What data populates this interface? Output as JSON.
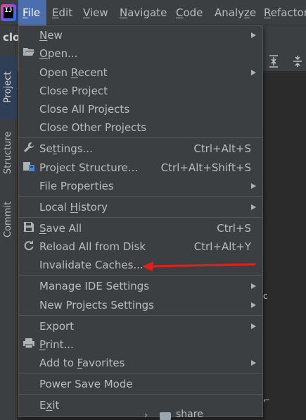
{
  "menubar": {
    "items": [
      {
        "label": "File",
        "mnemonic": "F"
      },
      {
        "label": "Edit",
        "mnemonic": "E"
      },
      {
        "label": "View",
        "mnemonic": "V"
      },
      {
        "label": "Navigate",
        "mnemonic": "N"
      },
      {
        "label": "Code",
        "mnemonic": "C"
      },
      {
        "label": "Analyze",
        "mnemonic": "z"
      },
      {
        "label": "Refactor",
        "mnemonic": "R"
      }
    ],
    "active": "File"
  },
  "left_strip": {
    "tabs": [
      {
        "label": "Project",
        "selected": true
      },
      {
        "label": "Structure",
        "selected": false
      },
      {
        "label": "Commit",
        "selected": false
      }
    ]
  },
  "panel": {
    "title_fragment": "clo"
  },
  "file_menu": {
    "items": [
      {
        "label": "New",
        "shortcut": "",
        "submenu": true,
        "icon": ""
      },
      {
        "label": "Open...",
        "shortcut": "",
        "submenu": false,
        "icon": "folder-open-icon"
      },
      {
        "label": "Open Recent",
        "shortcut": "",
        "submenu": true,
        "icon": ""
      },
      {
        "label": "Close Project",
        "shortcut": "",
        "submenu": false,
        "icon": ""
      },
      {
        "label": "Close All Projects",
        "shortcut": "",
        "submenu": false,
        "icon": ""
      },
      {
        "label": "Close Other Projects",
        "shortcut": "",
        "submenu": false,
        "icon": ""
      },
      {
        "label": "Settings...",
        "shortcut": "Ctrl+Alt+S",
        "submenu": false,
        "icon": "wrench-icon"
      },
      {
        "label": "Project Structure...",
        "shortcut": "Ctrl+Alt+Shift+S",
        "submenu": false,
        "icon": "project-structure-icon"
      },
      {
        "label": "File Properties",
        "shortcut": "",
        "submenu": true,
        "icon": ""
      },
      {
        "label": "Local History",
        "shortcut": "",
        "submenu": true,
        "icon": ""
      },
      {
        "label": "Save All",
        "shortcut": "Ctrl+S",
        "submenu": false,
        "icon": "save-icon"
      },
      {
        "label": "Reload All from Disk",
        "shortcut": "Ctrl+Alt+Y",
        "submenu": false,
        "icon": "reload-icon"
      },
      {
        "label": "Invalidate Caches...",
        "shortcut": "",
        "submenu": false,
        "icon": ""
      },
      {
        "label": "Manage IDE Settings",
        "shortcut": "",
        "submenu": true,
        "icon": ""
      },
      {
        "label": "New Projects Settings",
        "shortcut": "",
        "submenu": true,
        "icon": ""
      },
      {
        "label": "Export",
        "shortcut": "",
        "submenu": true,
        "icon": ""
      },
      {
        "label": "Print...",
        "shortcut": "",
        "submenu": false,
        "icon": "print-icon"
      },
      {
        "label": "Add to Favorites",
        "shortcut": "",
        "submenu": true,
        "icon": ""
      },
      {
        "label": "Power Save Mode",
        "shortcut": "",
        "submenu": false,
        "icon": ""
      },
      {
        "label": "Exit",
        "shortcut": "",
        "submenu": false,
        "icon": ""
      }
    ]
  },
  "tree": {
    "visible_row_label": "share"
  },
  "colors": {
    "menu_bg": "#3c3f41",
    "active_menu": "#4b6eaf",
    "annotation_arrow": "#e0201d"
  }
}
